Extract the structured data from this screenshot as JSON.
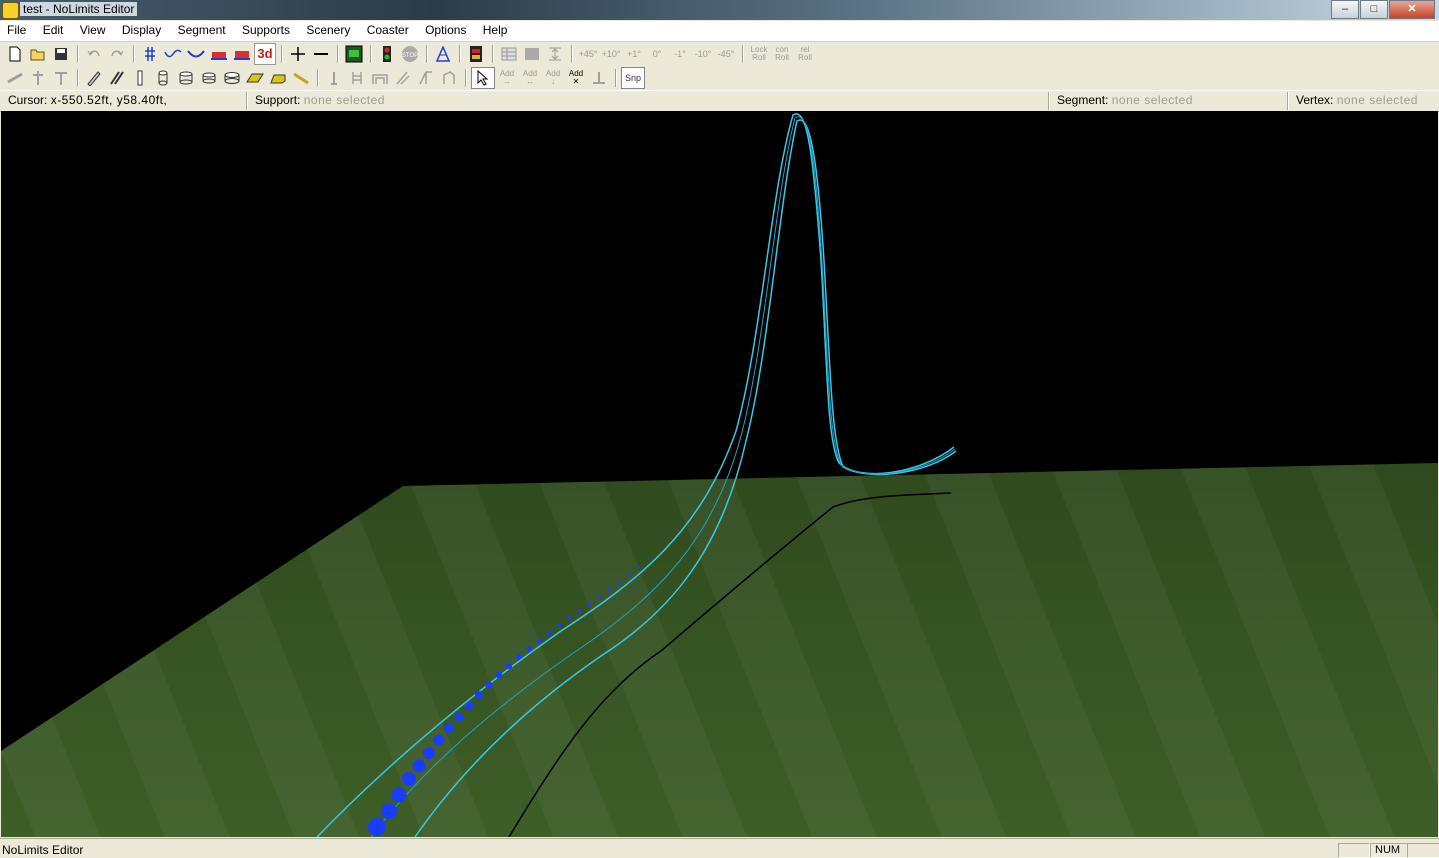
{
  "window": {
    "title": "test - NoLimits Editor",
    "buttons": {
      "minimize": "–",
      "maximize": "□",
      "close": "✕"
    }
  },
  "menu": [
    "File",
    "Edit",
    "View",
    "Display",
    "Segment",
    "Supports",
    "Scenery",
    "Coaster",
    "Options",
    "Help"
  ],
  "toolbar1": {
    "label_3d": "3d",
    "stop": "STOP",
    "angles": [
      "+45°",
      "+10°",
      "+1°",
      "0°",
      "-1°",
      "-10°",
      "-45°"
    ],
    "lock_roll": [
      "Lock",
      "Roll"
    ],
    "con_roll": [
      "con",
      "Roll"
    ],
    "rel_roll": [
      "rel",
      "Roll"
    ]
  },
  "toolbar2": {
    "add_labels": [
      "Add",
      "Add",
      "Add",
      "Add"
    ],
    "snap": "Snp"
  },
  "status": {
    "cursor_label": "Cursor:",
    "cursor_value": "x-550.52ft, y58.40ft,",
    "support_label": "Support:",
    "support_value": "none selected",
    "segment_label": "Segment:",
    "segment_value": "none selected",
    "vertex_label": "Vertex:",
    "vertex_value": "none selected"
  },
  "bottom": {
    "message": "NoLimits Editor",
    "num": "NUM"
  },
  "colors": {
    "track": "#39c8e8",
    "spine": "#1a3cff",
    "ground": "#3c5a26",
    "sky": "#000000"
  }
}
